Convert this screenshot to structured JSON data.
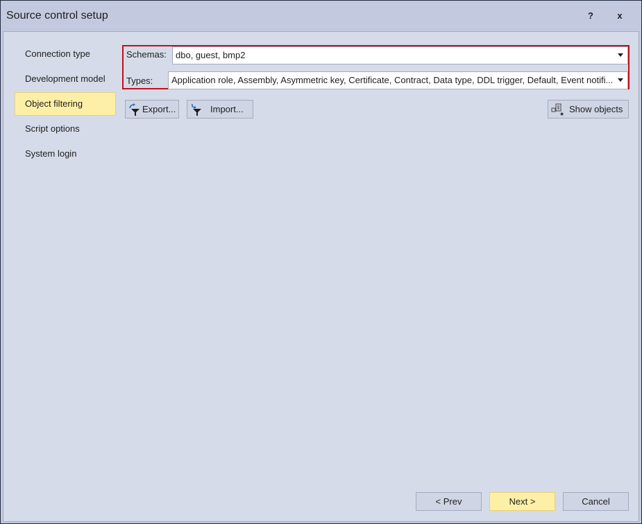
{
  "window": {
    "title": "Source control setup",
    "help_label": "?",
    "close_label": "x"
  },
  "sidebar": {
    "items": [
      {
        "label": "Connection type",
        "active": false
      },
      {
        "label": "Development model",
        "active": false
      },
      {
        "label": "Object filtering",
        "active": true
      },
      {
        "label": "Script options",
        "active": false
      },
      {
        "label": "System login",
        "active": false
      }
    ]
  },
  "filter": {
    "schemas_label": "Schemas:",
    "schemas_value": "dbo, guest, bmp2",
    "types_label": "Types:",
    "types_value": "Application role, Assembly, Asymmetric key, Certificate, Contract, Data type, DDL trigger, Default, Event notifi..."
  },
  "toolbar": {
    "export_label": "Export...",
    "import_label": "Import...",
    "show_objects_label": "Show objects"
  },
  "footer": {
    "prev_label": "< Prev",
    "next_label": "Next >",
    "cancel_label": "Cancel"
  },
  "colors": {
    "highlight_border": "#c0101a",
    "active_item_bg": "#fdf0a6"
  }
}
